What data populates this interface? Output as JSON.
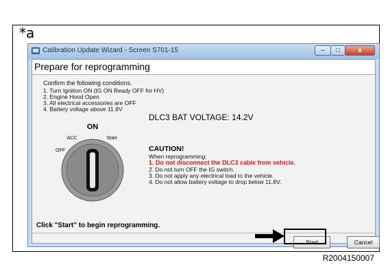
{
  "figure": {
    "label": "*a",
    "reference": "R2004150007"
  },
  "window": {
    "title": "Calibration Update Wizard - Screen S701-15",
    "heading": "Prepare for reprogramming",
    "controls": {
      "minimize": "–",
      "maximize": "□",
      "close": "x"
    }
  },
  "conditions": {
    "intro": "Confirm the following conditions.",
    "items": [
      "1. Turn Ignition ON (IG ON Ready OFF for HV)",
      "2. Engine Hood Open",
      "3. All electrical accessories are OFF",
      "4. Battery voltage above 11.8V"
    ]
  },
  "battery": {
    "voltage_text": "DLC3 BAT VOLTAGE: 14.2V"
  },
  "ignition_dial": {
    "on": "ON",
    "acc": "ACC",
    "off": "OFF",
    "start": "Start"
  },
  "caution": {
    "title": "CAUTION!",
    "intro": "When reprogramming:",
    "items": [
      "1. Do not disconnect the DLC3 cable from vehicle.",
      "2. Do not turn OFF the IG switch.",
      "3. Do not apply any electrical load to the vehicle.",
      "4. Do not allow battery voltage to drop below 11.8V."
    ],
    "warning_color": "#e01818"
  },
  "footer": {
    "hint": "Click \"Start\" to begin reprogramming."
  },
  "buttons": {
    "start": "Start",
    "cancel": "Cancel"
  }
}
